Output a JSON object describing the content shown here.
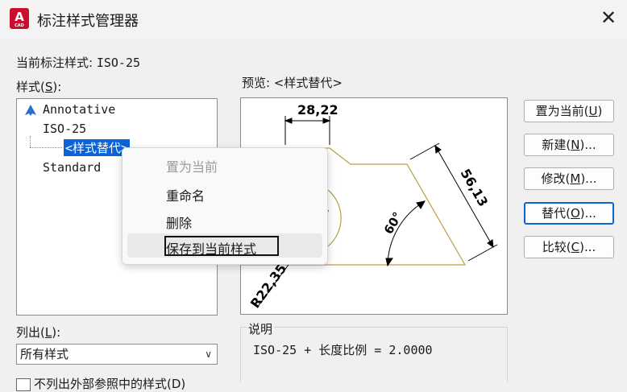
{
  "window": {
    "title": "标注样式管理器",
    "icon_letter": "A",
    "icon_caption": "CAD",
    "close_glyph": "✕"
  },
  "current_style": {
    "label": "当前标注样式: ",
    "value": "ISO-25"
  },
  "styles_label": {
    "pre": "样式(",
    "key": "S",
    "post": "):"
  },
  "styles": [
    {
      "name": "Annotative",
      "icon": "annotative-icon"
    },
    {
      "name": "ISO-25"
    },
    {
      "name": "<样式替代>",
      "selected": true
    },
    {
      "name": "Standard"
    }
  ],
  "preview": {
    "label": "预览: <样式替代>",
    "dims": {
      "top": "28,22",
      "right": "56,13",
      "angle": "60°",
      "radius": "R22,35"
    }
  },
  "buttons": [
    {
      "text": "置为当前(",
      "key": "U",
      "tail": ")"
    },
    {
      "text": "新建(",
      "key": "N",
      "tail": ")..."
    },
    {
      "text": "修改(",
      "key": "M",
      "tail": ")..."
    },
    {
      "text": "替代(",
      "key": "O",
      "tail": ")...",
      "active": true
    },
    {
      "text": "比较(",
      "key": "C",
      "tail": ")..."
    }
  ],
  "list_label": {
    "pre": "列出(",
    "key": "L",
    "post": "):"
  },
  "list_value": "所有样式",
  "description": {
    "label": "说明",
    "text": "ISO-25 + 长度比例 = 2.0000"
  },
  "context_menu": [
    {
      "label": "置为当前",
      "disabled": true
    },
    {
      "label": "重命名"
    },
    {
      "label": "删除"
    },
    {
      "label": "保存到当前样式",
      "highlighted": true
    }
  ],
  "bottom_option_partial": "不列出外部参照中的样式(D)",
  "colors": {
    "accent": "#0a64d8",
    "geometry": "#b8a040",
    "app_red": "#c8102e"
  }
}
